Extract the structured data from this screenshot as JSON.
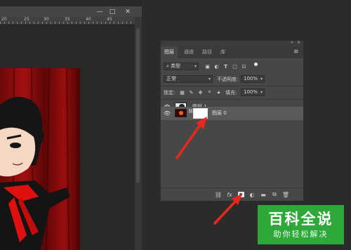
{
  "doc_window": {
    "controls": {
      "minimize": "—",
      "maximize": "□",
      "close": "✕"
    },
    "ruler_labels": [
      "20",
      "25",
      "30",
      "35",
      "40",
      "45"
    ]
  },
  "layers_panel": {
    "tabs": [
      "图层",
      "通道",
      "路径",
      "库"
    ],
    "active_tab": "图层",
    "filter": {
      "value": "类型"
    },
    "blend_mode": "正常",
    "opacity_label": "不透明度:",
    "opacity_value": "100%",
    "lock_label": "锁定:",
    "fill_label": "填充:",
    "fill_value": "100%",
    "layers": [
      {
        "name": "图层 1",
        "selected": false
      },
      {
        "name": "图层 0",
        "selected": true
      }
    ],
    "footer_icons": [
      "link-icon",
      "fx-icon",
      "add-mask-icon",
      "adjustment-icon",
      "group-icon",
      "new-layer-icon",
      "delete-icon"
    ],
    "fx_label": "fx"
  },
  "watermark": {
    "line1": "百科全说",
    "line2": "助你轻松解决"
  },
  "colors": {
    "annotation_arrow": "#e8281c",
    "watermark_bg": "#2fa83a",
    "canvas_red": "#8a0d0d"
  }
}
